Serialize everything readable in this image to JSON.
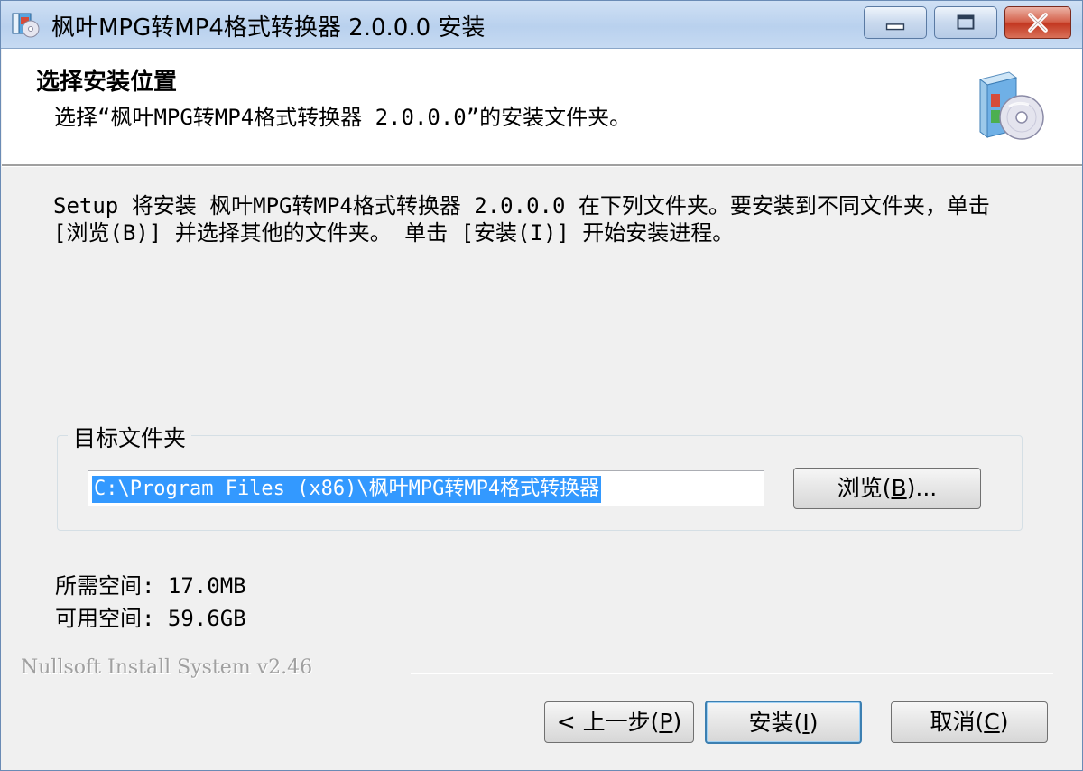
{
  "window": {
    "title": "枫叶MPG转MP4格式转换器 2.0.0.0 安装"
  },
  "header": {
    "title": "选择安装位置",
    "subtitle": "选择“枫叶MPG转MP4格式转换器 2.0.0.0”的安装文件夹。"
  },
  "body": {
    "description": "Setup 将安装 枫叶MPG转MP4格式转换器 2.0.0.0 在下列文件夹。要安装到不同文件夹，单击 [浏览(B)] 并选择其他的文件夹。 单击 [安装(I)] 开始安装进程。"
  },
  "destination": {
    "group_label": "目标文件夹",
    "path_value": "C:\\Program Files (x86)\\枫叶MPG转MP4格式转换器",
    "browse_label_pre": "浏览(",
    "browse_key": "B",
    "browse_label_post": ")..."
  },
  "space": {
    "required": "所需空间: 17.0MB",
    "available": "可用空间: 59.6GB"
  },
  "branding": "Nullsoft Install System v2.46",
  "buttons": {
    "back_pre": "< 上一步(",
    "back_key": "P",
    "back_post": ")",
    "install_pre": "安装(",
    "install_key": "I",
    "install_post": ")",
    "cancel_pre": "取消(",
    "cancel_key": "C",
    "cancel_post": ")"
  },
  "icons": {
    "app": "installer-app-icon",
    "header": "software-box-cd-icon",
    "minimize": "minimize-icon",
    "maximize": "maximize-icon",
    "close": "close-icon"
  },
  "colors": {
    "selection": "#3399ff",
    "close_button": "#c2361f",
    "default_button_border": "#3c7fb1"
  }
}
